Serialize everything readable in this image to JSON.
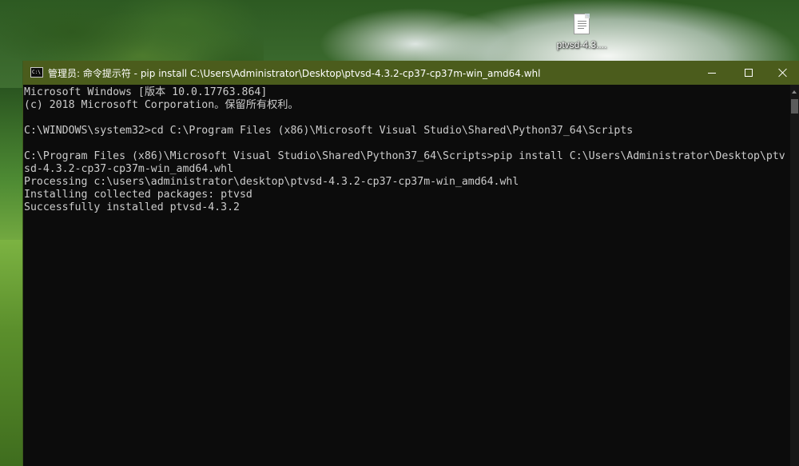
{
  "desktop": {
    "icon_label": "ptvsd-4.3...."
  },
  "window": {
    "icon_text": "C:\\",
    "title": "管理员: 命令提示符 - pip  install C:\\Users\\Administrator\\Desktop\\ptvsd-4.3.2-cp37-cp37m-win_amd64.whl",
    "title_bar_color": "#4b5c1c",
    "background_color": "#0c0c0c",
    "text_color": "#cccccc"
  },
  "console": {
    "lines": [
      "Microsoft Windows [版本 10.0.17763.864]",
      "(c) 2018 Microsoft Corporation。保留所有权利。",
      "",
      "C:\\WINDOWS\\system32>cd C:\\Program Files (x86)\\Microsoft Visual Studio\\Shared\\Python37_64\\Scripts",
      "",
      "C:\\Program Files (x86)\\Microsoft Visual Studio\\Shared\\Python37_64\\Scripts>pip install C:\\Users\\Administrator\\Desktop\\ptv",
      "sd-4.3.2-cp37-cp37m-win_amd64.whl",
      "Processing c:\\users\\administrator\\desktop\\ptvsd-4.3.2-cp37-cp37m-win_amd64.whl",
      "Installing collected packages: ptvsd",
      "Successfully installed ptvsd-4.3.2"
    ]
  },
  "icons": {
    "desktop_file": "file-document-icon",
    "window_app": "command-prompt-icon",
    "minimize": "minimize-icon",
    "maximize": "maximize-icon",
    "close": "close-icon",
    "scroll_up": "scroll-up-arrow-icon"
  }
}
